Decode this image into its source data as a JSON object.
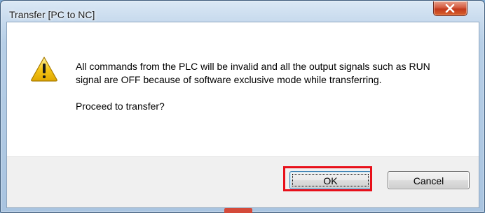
{
  "window": {
    "title": "Transfer [PC to NC]",
    "close_symbol": "X"
  },
  "dialog": {
    "icon": "warning-icon",
    "message": "All commands from the PLC will be invalid and all the output signals such as RUN signal are OFF because of software exclusive mode while transferring.",
    "question": "Proceed to transfer?"
  },
  "buttons": {
    "ok_label": "OK",
    "cancel_label": "Cancel"
  },
  "colors": {
    "highlight": "#e8101a",
    "close_button": "#c23a1d",
    "warning_fill": "#f5c518"
  }
}
